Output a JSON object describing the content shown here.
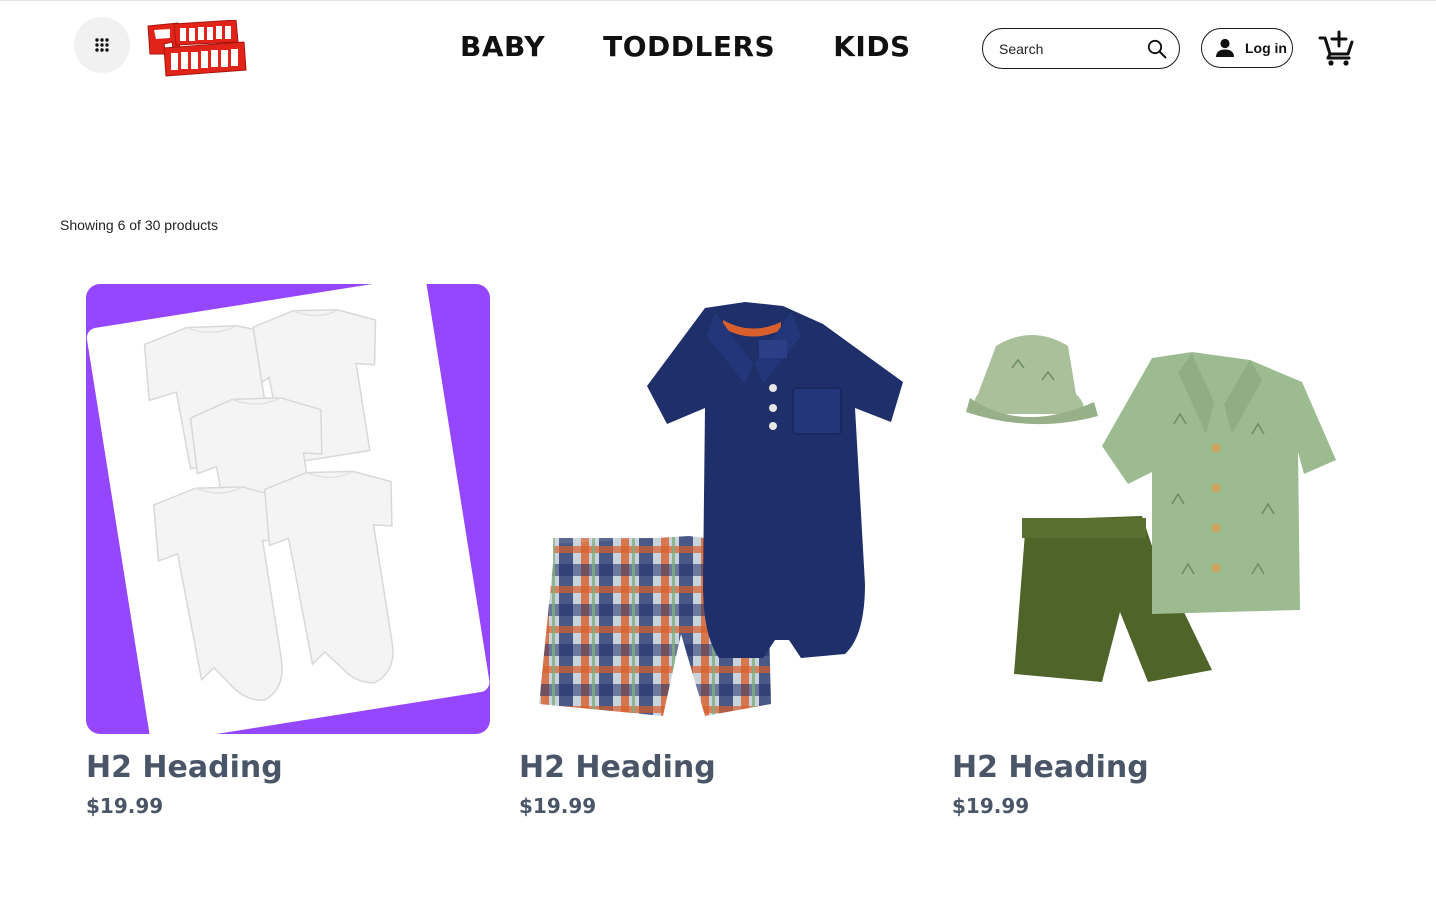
{
  "header": {
    "logo_text": "GREATER HEIGHTS",
    "nav": [
      {
        "label": "BABY"
      },
      {
        "label": "TODDLERS"
      },
      {
        "label": "KIDS"
      }
    ],
    "search": {
      "placeholder": "Search",
      "value": ""
    },
    "login_label": "Log in"
  },
  "results": {
    "summary": "Showing 6 of 30 products"
  },
  "products": [
    {
      "title": "H2 Heading",
      "price": "$19.99"
    },
    {
      "title": "H2 Heading",
      "price": "$19.99"
    },
    {
      "title": "H2 Heading",
      "price": "$19.99"
    }
  ],
  "colors": {
    "brand_red": "#e2231a",
    "highlight_purple": "#9547ff",
    "heading_slate": "#4a5568"
  }
}
